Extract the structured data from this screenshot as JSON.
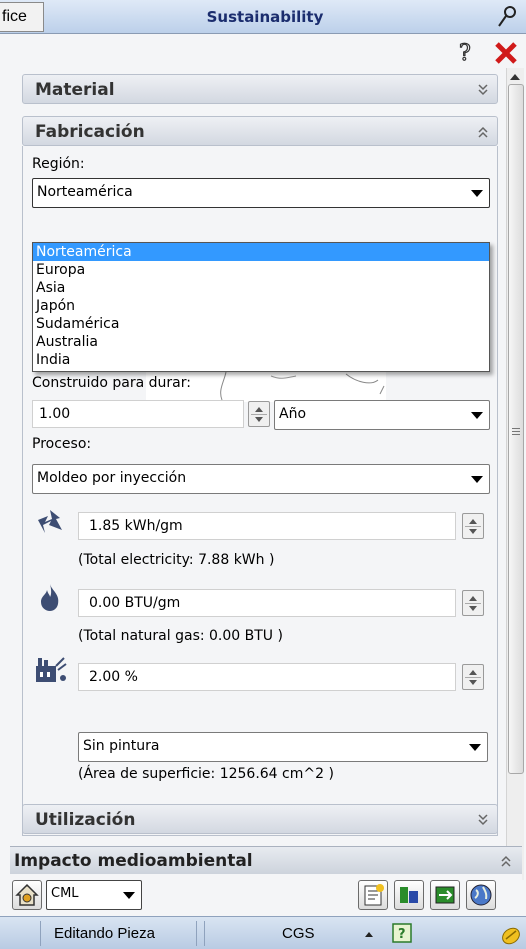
{
  "window": {
    "office_tab": "fice",
    "title": "Sustainability"
  },
  "sections": {
    "material": "Material",
    "fabricacion": "Fabricación",
    "utilizacion": "Utilización"
  },
  "fabricacion": {
    "region_label": "Región:",
    "region_value": "Norteamérica",
    "region_options": [
      "Norteamérica",
      "Europa",
      "Asia",
      "Japón",
      "Sudamérica",
      "Australia",
      "India"
    ],
    "built_to_last_label": "Construido para durar:",
    "built_to_last_value": "1.00",
    "built_to_last_unit": "Año",
    "process_label": "Proceso:",
    "process_value": "Moldeo por inyección",
    "electricity_value": "1.85 kWh/gm",
    "electricity_total": "(Total electricity: 7.88 kWh )",
    "gas_value": "0.00 BTU/gm",
    "gas_total": "(Total natural gas: 0.00 BTU )",
    "scrap_value": "2.00 %",
    "paint_value": "Sin pintura",
    "surface_area": "(Área de superficie: 1256.64 cm^2 )"
  },
  "impact": {
    "title": "Impacto medioambiental",
    "method": "CML"
  },
  "status": {
    "mode": "Editando Pieza",
    "units": "CGS"
  },
  "icons": {
    "electricity": "lightning-icon",
    "gas": "flame-icon",
    "scrap": "factory-icon",
    "help": "question-icon",
    "close": "close-icon"
  },
  "colors": {
    "selection": "#3399ff",
    "close_red": "#d01a1a",
    "title_blue": "#1b2d6e"
  }
}
